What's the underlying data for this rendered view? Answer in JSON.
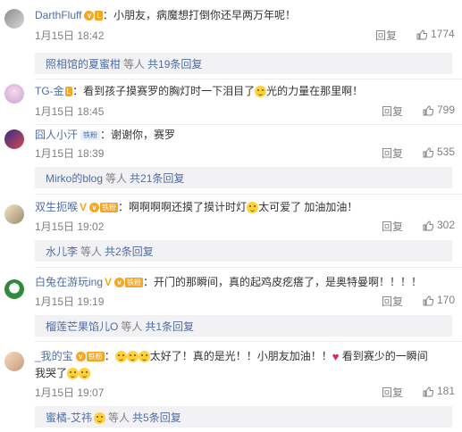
{
  "comments": [
    {
      "username": "DarthFluff",
      "text": "小朋友，病魔想打倒你还早两万年呢！",
      "time": "1月15日 18:42",
      "reply_label": "回复",
      "likes": "1774",
      "sub": {
        "name": "照相馆的夏蜜柑",
        "mid": "等人",
        "more": "共19条回复"
      }
    },
    {
      "username": "TG-金",
      "text_a": "看到孩子摸赛罗的胸灯时一下泪目了",
      "text_b": "光的力量在那里啊！",
      "time": "1月15日 18:45",
      "reply_label": "回复",
      "likes": "799"
    },
    {
      "username": "囧人小汗",
      "fan_badge": "铁粉",
      "text": "谢谢你，赛罗",
      "time": "1月15日 18:39",
      "reply_label": "回复",
      "likes": "535",
      "sub": {
        "name": "Mirko的blog",
        "mid": "等人",
        "more": "共21条回复"
      }
    },
    {
      "username": "双生扼喉",
      "level": "铁粉",
      "text_a": "啊啊啊啊还摸了摸计时灯",
      "text_b": "太可爱了 加油加油！",
      "time": "1月15日 19:02",
      "reply_label": "回复",
      "likes": "302",
      "sub": {
        "name": "水儿李",
        "mid": "等人",
        "more": "共2条回复"
      }
    },
    {
      "username": "白兔在游玩ing",
      "level": "铁粉",
      "text": "开门的那瞬间，真的起鸡皮疙瘩了，是奥特曼啊！！！！",
      "time": "1月15日 19:19",
      "reply_label": "回复",
      "likes": "170",
      "sub": {
        "name": "榴莲芒果馅儿O",
        "mid": "等人",
        "more": "共1条回复"
      }
    },
    {
      "username": "_我的宝",
      "level": "铁粉",
      "text_a": "太好了！真的是光！！小朋友加油！！",
      "text_b": "看到赛少的一瞬间",
      "text_c": "我哭了",
      "time": "1月15日 19:07",
      "reply_label": "回复",
      "likes": "181",
      "sub": {
        "name": "蜜橘-艾祎",
        "mid": "等人",
        "more": "共5条回复"
      }
    }
  ],
  "colors": {
    "link": "#4e6ea6",
    "muted": "#808080",
    "gold": "#f5a623",
    "subbg": "#f2f2f5"
  }
}
